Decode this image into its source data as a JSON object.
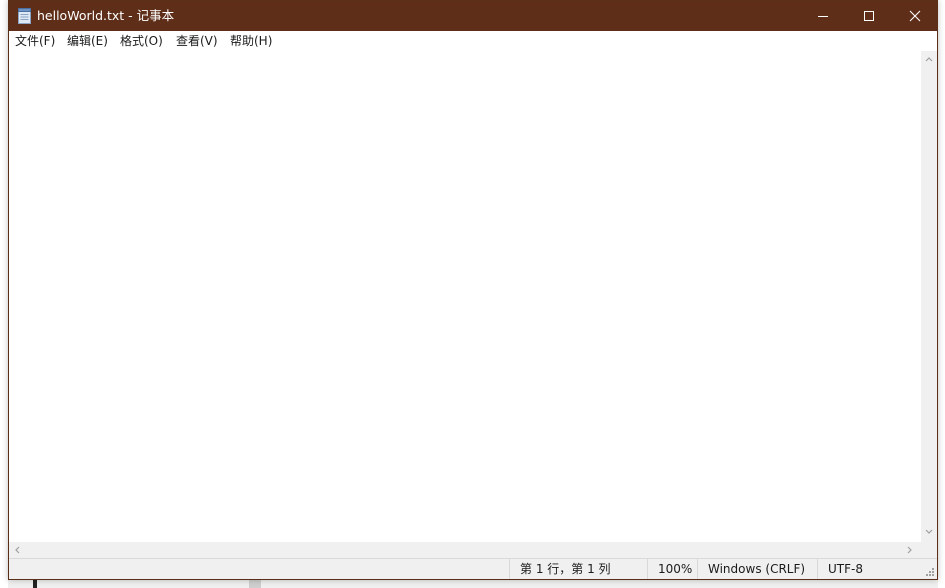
{
  "window": {
    "title": "helloWorld.txt - 记事本",
    "titlebar_color": "#5e2e18"
  },
  "icons": {
    "app": "notepad-icon",
    "minimize": "minimize-icon",
    "maximize": "maximize-icon",
    "close": "close-icon"
  },
  "menu": {
    "items": [
      {
        "label": "文件(F)"
      },
      {
        "label": "编辑(E)"
      },
      {
        "label": "格式(O)"
      },
      {
        "label": "查看(V)"
      },
      {
        "label": "帮助(H)"
      }
    ]
  },
  "editor": {
    "content": ""
  },
  "status": {
    "position": "第 1 行，第 1 列",
    "zoom": "100%",
    "line_ending": "Windows (CRLF)",
    "encoding": "UTF-8"
  }
}
